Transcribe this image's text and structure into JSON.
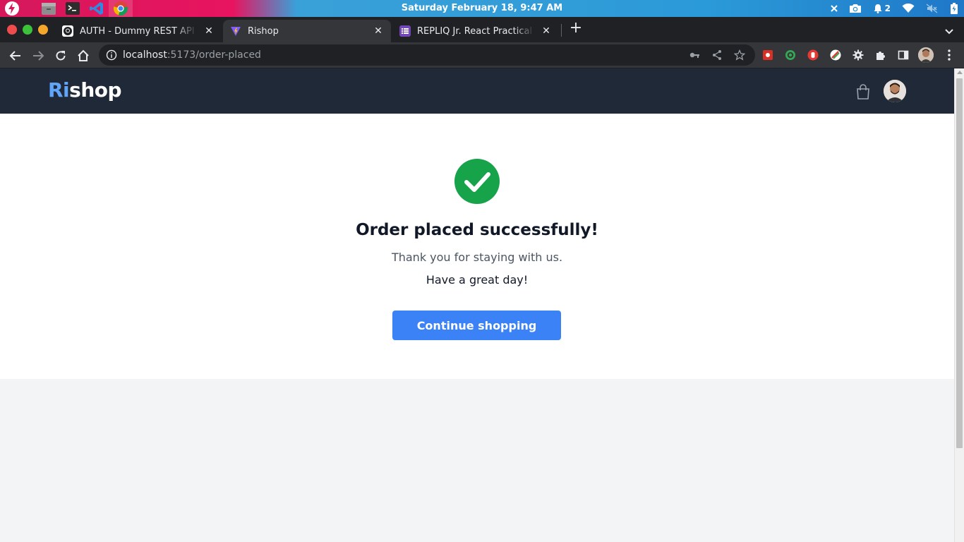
{
  "os": {
    "clock": "Saturday February 18,  9:47 AM",
    "apps": [
      "thunder-app-icon",
      "files-icon",
      "terminal-icon",
      "vscode-icon",
      "chrome-icon"
    ],
    "tray": {
      "notifications_count": "2"
    }
  },
  "browser": {
    "tabs": [
      {
        "title": "AUTH - Dummy REST API of JS",
        "favicon": "github-icon",
        "active": false
      },
      {
        "title": "Rishop",
        "favicon": "vite-icon",
        "active": true
      },
      {
        "title": "REPLIQ Jr. React Practical Cha",
        "favicon": "form-icon",
        "active": false
      }
    ],
    "url": {
      "host": "localhost",
      "path": ":5173/order-placed"
    }
  },
  "app": {
    "brand_accent": "Ri",
    "brand_rest": "shop",
    "heading": "Order placed successfully!",
    "message": "Thank you for staying with us.",
    "greeting": "Have a great day!",
    "continue_label": "Continue shopping"
  },
  "colors": {
    "navbar": "#1f2937",
    "accent": "#60a5fa",
    "button": "#3b82f6",
    "success": "#16a34a"
  }
}
